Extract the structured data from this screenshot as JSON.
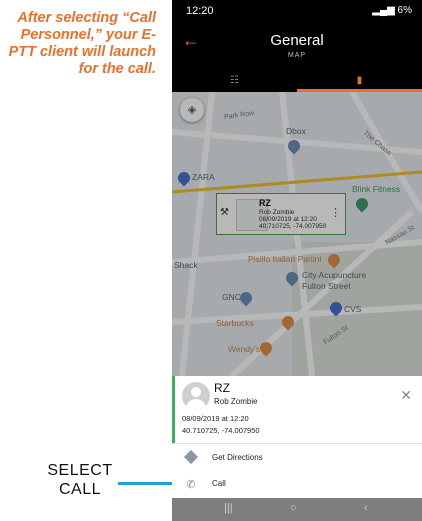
{
  "annotation": {
    "caption": "After selecting “Call Personnel,” your E-PTT client will launch for the call.",
    "select_line1": "SELECT",
    "select_line2": "CALL"
  },
  "status_bar": {
    "time": "12:20",
    "battery": "6%"
  },
  "app_bar": {
    "title": "General",
    "subtitle": "MAP",
    "tabs": [
      {
        "label": "LIST",
        "icon": "grid-icon",
        "active": false
      },
      {
        "label": "",
        "icon": "map-icon",
        "active": true
      }
    ]
  },
  "map": {
    "labels": {
      "park_row": "Park Row",
      "dbox": "Dbox",
      "zara": "ZARA",
      "the_chase": "The Chase",
      "blink": "Blink Fitness",
      "pisillo": "Pisillo Italian Panini",
      "city_acu": "City Acupuncture",
      "fulton": "Fulton Street",
      "gnc": "GNC",
      "cvs": "CVS",
      "starbucks": "Starbucks",
      "wendys": "Wendy's",
      "shack": "Shack",
      "fulton_st": "Fulton St",
      "nassau_st": "Nassau St"
    },
    "popup": {
      "initials": "RZ",
      "name": "Rob Zombie",
      "datetime": "08/09/2019 at 12:20",
      "coords": "40.710725, -74.007950"
    }
  },
  "sheet": {
    "initials": "RZ",
    "name": "Rob Zombie",
    "datetime": "08/09/2019 at 12:20",
    "coords": "40.710725, -74.007950",
    "actions": [
      {
        "label": "Get Directions",
        "icon": "directions-icon"
      },
      {
        "label": "Call",
        "icon": "phone-icon"
      }
    ]
  },
  "colors": {
    "accent": "#e8702a",
    "annotation_line": "#1ea0d6",
    "sheet_accent": "#3cae5c"
  }
}
